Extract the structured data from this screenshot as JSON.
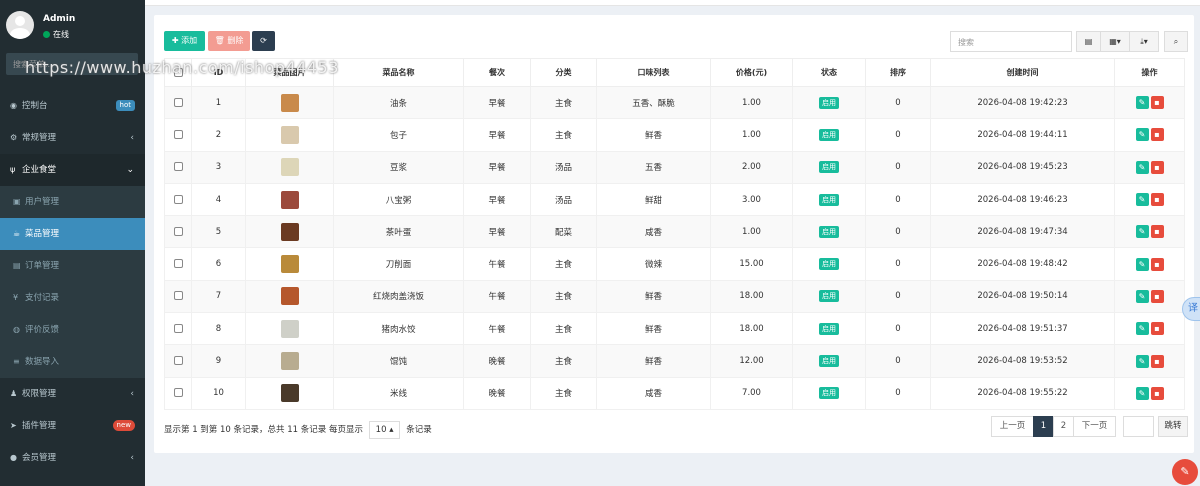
{
  "user": {
    "name": "Admin",
    "status": "在线"
  },
  "sidebar": {
    "search_placeholder": "搜索菜单...",
    "items": [
      {
        "label": "控制台",
        "icon": "dashboard-icon",
        "badge": "hot"
      },
      {
        "label": "常规管理",
        "icon": "cogs-icon",
        "arrow": "‹"
      },
      {
        "label": "企业食堂",
        "icon": "cutlery-icon",
        "arrow": "⌄"
      },
      {
        "label": "用户管理",
        "icon": "user-icon"
      },
      {
        "label": "菜品管理",
        "icon": "dish-icon"
      },
      {
        "label": "订单管理",
        "icon": "list-icon"
      },
      {
        "label": "支付记录",
        "icon": "yen-icon",
        "glyph": "¥"
      },
      {
        "label": "评价反馈",
        "icon": "comment-icon"
      },
      {
        "label": "数据导入",
        "icon": "database-icon"
      },
      {
        "label": "权限管理",
        "icon": "group-icon",
        "arrow": "‹"
      },
      {
        "label": "插件管理",
        "icon": "rocket-icon",
        "badge": "new"
      },
      {
        "label": "会员管理",
        "icon": "user-circle-icon",
        "arrow": "‹"
      }
    ]
  },
  "toolbar": {
    "add_label": "添加",
    "delete_label": "删除",
    "search_placeholder": "搜索"
  },
  "table": {
    "columns": [
      "ID",
      "菜品图片",
      "菜品名称",
      "餐次",
      "分类",
      "口味列表",
      "价格(元)",
      "状态",
      "排序",
      "创建时间",
      "操作"
    ],
    "status_label": "启用",
    "rows": [
      {
        "id": "1",
        "name": "油条",
        "meal": "早餐",
        "category": "主食",
        "taste": "五香、酥脆",
        "price": "1.00",
        "sort": "0",
        "created": "2026-04-08 19:42:23",
        "thumb": "#c98a4b"
      },
      {
        "id": "2",
        "name": "包子",
        "meal": "早餐",
        "category": "主食",
        "taste": "鲜香",
        "price": "1.00",
        "sort": "0",
        "created": "2026-04-08 19:44:11",
        "thumb": "#d9c9ad"
      },
      {
        "id": "3",
        "name": "豆浆",
        "meal": "早餐",
        "category": "汤品",
        "taste": "五香",
        "price": "2.00",
        "sort": "0",
        "created": "2026-04-08 19:45:23",
        "thumb": "#ddd6b8"
      },
      {
        "id": "4",
        "name": "八宝粥",
        "meal": "早餐",
        "category": "汤品",
        "taste": "鲜甜",
        "price": "3.00",
        "sort": "0",
        "created": "2026-04-08 19:46:23",
        "thumb": "#9b4a3c"
      },
      {
        "id": "5",
        "name": "茶叶蛋",
        "meal": "早餐",
        "category": "配菜",
        "taste": "咸香",
        "price": "1.00",
        "sort": "0",
        "created": "2026-04-08 19:47:34",
        "thumb": "#6b3a22"
      },
      {
        "id": "6",
        "name": "刀削面",
        "meal": "午餐",
        "category": "主食",
        "taste": "微辣",
        "price": "15.00",
        "sort": "0",
        "created": "2026-04-08 19:48:42",
        "thumb": "#b98a3a"
      },
      {
        "id": "7",
        "name": "红烧肉盖浇饭",
        "meal": "午餐",
        "category": "主食",
        "taste": "鲜香",
        "price": "18.00",
        "sort": "0",
        "created": "2026-04-08 19:50:14",
        "thumb": "#b5572c"
      },
      {
        "id": "8",
        "name": "猪肉水饺",
        "meal": "午餐",
        "category": "主食",
        "taste": "鲜香",
        "price": "18.00",
        "sort": "0",
        "created": "2026-04-08 19:51:37",
        "thumb": "#cfd0c8"
      },
      {
        "id": "9",
        "name": "馄饨",
        "meal": "晚餐",
        "category": "主食",
        "taste": "鲜香",
        "price": "12.00",
        "sort": "0",
        "created": "2026-04-08 19:53:52",
        "thumb": "#b8ac90"
      },
      {
        "id": "10",
        "name": "米线",
        "meal": "晚餐",
        "category": "主食",
        "taste": "咸香",
        "price": "7.00",
        "sort": "0",
        "created": "2026-04-08 19:55:22",
        "thumb": "#4a3a2a"
      }
    ]
  },
  "pagination": {
    "info_prefix": "显示第 1 到第 10 条记录，总共 11 条记录 每页显示",
    "page_size": "10",
    "info_suffix": "条记录",
    "prev": "上一页",
    "pages": [
      "1",
      "2"
    ],
    "next": "下一页",
    "go": "跳转"
  },
  "watermark": "https://www.huzhan.com/ishop44453",
  "translate_label": "译"
}
